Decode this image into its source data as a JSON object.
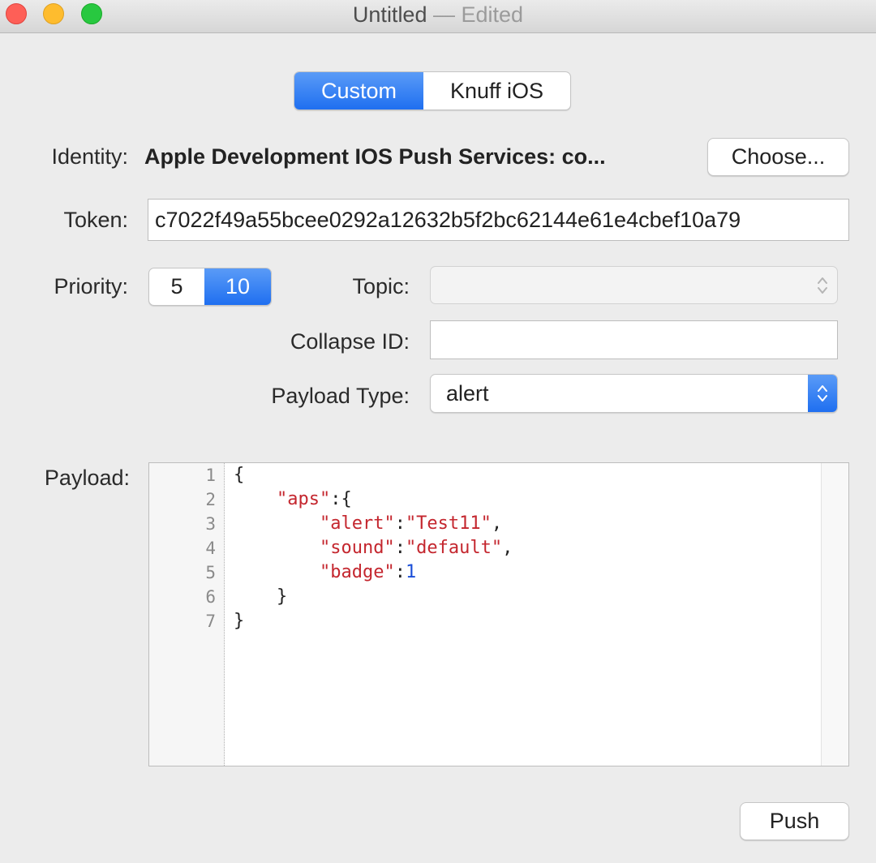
{
  "window": {
    "title": "Untitled",
    "title_separator": "—",
    "title_state": "Edited"
  },
  "mode_tabs": [
    {
      "label": "Custom",
      "selected": true
    },
    {
      "label": "Knuff iOS",
      "selected": false
    }
  ],
  "identity": {
    "label": "Identity:",
    "value": "Apple Development IOS Push Services: co...",
    "choose_label": "Choose..."
  },
  "token": {
    "label": "Token:",
    "value": "c7022f49a55bcee0292a12632b5f2bc62144e61e4cbef10a79"
  },
  "priority": {
    "label": "Priority:",
    "options": [
      {
        "label": "5",
        "selected": false
      },
      {
        "label": "10",
        "selected": true
      }
    ]
  },
  "topic": {
    "label": "Topic:",
    "value": ""
  },
  "collapse_id": {
    "label": "Collapse ID:",
    "value": ""
  },
  "payload_type": {
    "label": "Payload Type:",
    "value": "alert"
  },
  "payload": {
    "label": "Payload:",
    "line_numbers": [
      "1",
      "2",
      "3",
      "4",
      "5",
      "6",
      "7"
    ],
    "lines": [
      "{",
      "    \"aps\":{",
      "        \"alert\":\"Test11\",",
      "        \"sound\":\"default\",",
      "        \"badge\":1",
      "    }",
      "}"
    ]
  },
  "push_label": "Push",
  "colors": {
    "accent": "#1f6ff0",
    "json_string": "#c4262e",
    "json_number": "#1a4ed8"
  }
}
